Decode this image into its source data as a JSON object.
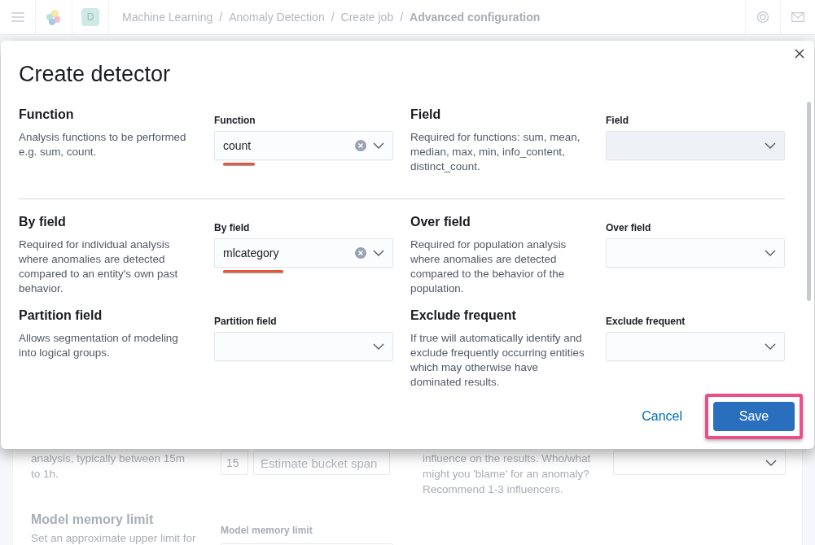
{
  "header": {
    "avatar": "D",
    "separator": "/",
    "breadcrumbs": [
      {
        "label": "Machine Learning",
        "current": false
      },
      {
        "label": "Anomaly Detection",
        "current": false
      },
      {
        "label": "Create job",
        "current": false
      },
      {
        "label": "Advanced configuration",
        "current": true
      }
    ]
  },
  "background": {
    "rows": [
      {
        "left_text": "analysis, typically between 15m to 1h.",
        "small_field": "15",
        "field_placeholder": "Estimate bucket span",
        "right_text": "influence on the results. Who/what might you 'blame' for an anomaly? Recommend 1-3 influencers."
      },
      {
        "heading": "Model memory limit",
        "label": "Model memory limit",
        "left_text": "Set an approximate upper limit for"
      }
    ]
  },
  "modal": {
    "title": "Create detector",
    "rows": [
      {
        "divider_after": true,
        "sections": [
          {
            "title": "Function",
            "description": "Analysis functions to be performed e.g. sum, count.",
            "label": "Function",
            "value": "count",
            "disabled": false,
            "annotated": true
          },
          {
            "title": "Field",
            "description": "Required for functions: sum, mean, median, max, min, info_content, distinct_count.",
            "label": "Field",
            "disabled": true,
            "annotated": false
          }
        ]
      },
      {
        "divider_after": false,
        "sections": [
          {
            "title": "By field",
            "description": "Required for individual analysis where anomalies are detected compared to an entity's own past behavior.",
            "label": "By field",
            "value": "mlcategory",
            "disabled": false,
            "annotated": true
          },
          {
            "title": "Over field",
            "description": "Required for population analysis where anomalies are detected compared to the behavior of the population.",
            "label": "Over field",
            "disabled": false,
            "annotated": false
          }
        ]
      },
      {
        "divider_after": false,
        "sections": [
          {
            "title": "Partition field",
            "description": "Allows segmentation of modeling into logical groups.",
            "label": "Partition field",
            "disabled": false,
            "annotated": false
          },
          {
            "title": "Exclude frequent",
            "description": "If true will automatically identify and exclude frequently occurring entities which may otherwise have dominated results.",
            "label": "Exclude frequent",
            "disabled": false,
            "annotated": false
          }
        ]
      }
    ],
    "cancel": "Cancel",
    "save": {
      "label": "Save",
      "highlighted": true
    }
  }
}
